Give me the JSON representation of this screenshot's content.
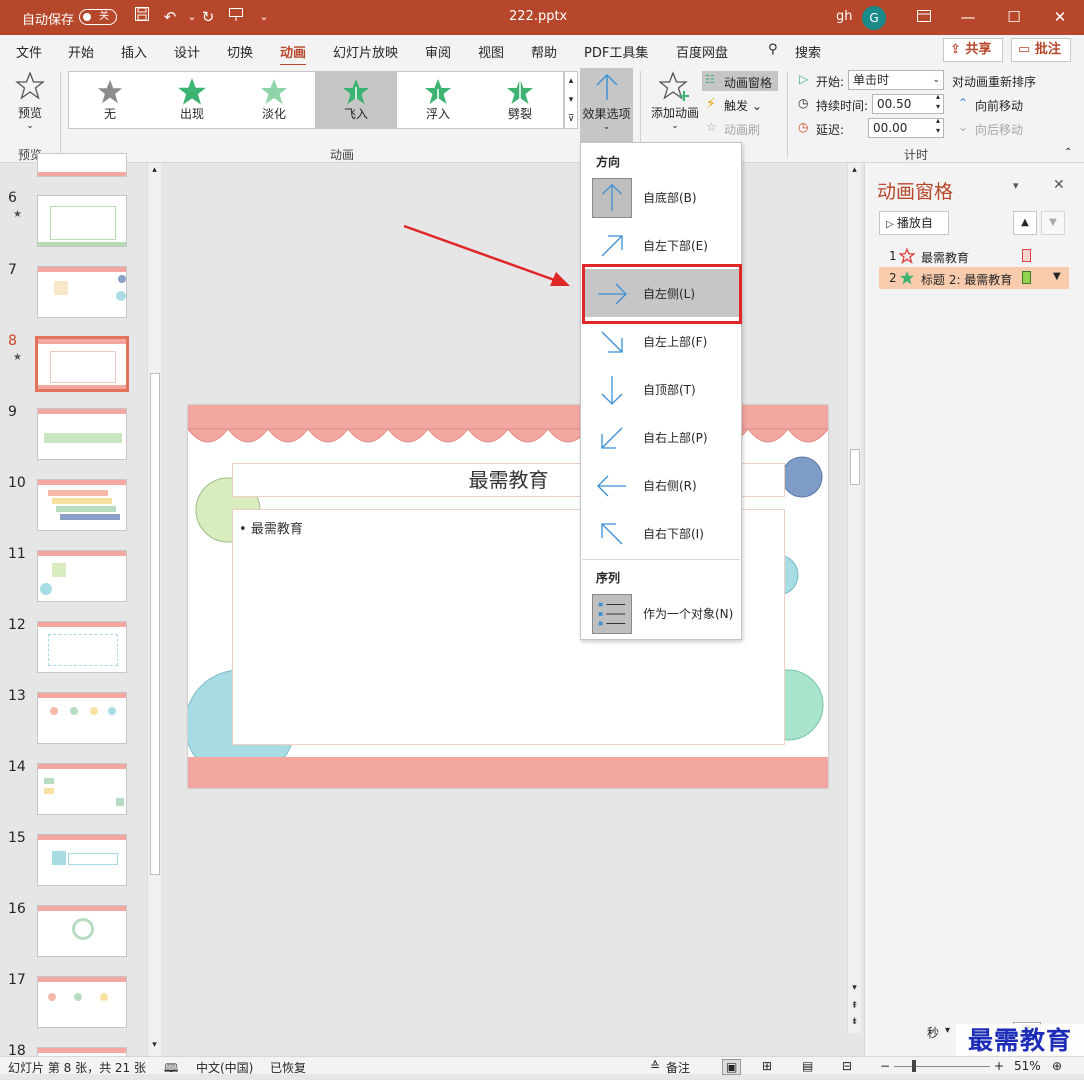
{
  "titlebar": {
    "autosave_label": "自动保存",
    "autosave_state": "关",
    "filename": "222.pptx",
    "user_initials": "gh",
    "avatar_letter": "G"
  },
  "menu": {
    "items": [
      "文件",
      "开始",
      "插入",
      "设计",
      "切换",
      "动画",
      "幻灯片放映",
      "审阅",
      "视图",
      "帮助",
      "PDF工具集",
      "百度网盘"
    ],
    "active": "动画",
    "search": "搜索",
    "share": "共享",
    "comments": "批注"
  },
  "ribbon": {
    "preview_label": "预览",
    "preview_group": "预览",
    "gallery": [
      {
        "label": "无",
        "color": "#808080"
      },
      {
        "label": "出现",
        "color": "#3cb371"
      },
      {
        "label": "淡化",
        "color": "#3cb371"
      },
      {
        "label": "飞入",
        "color": "#3cb371"
      },
      {
        "label": "浮入",
        "color": "#3cb371"
      },
      {
        "label": "劈裂",
        "color": "#3cb371"
      }
    ],
    "selected_effect": "飞入",
    "animation_group": "动画",
    "effect_options": "效果选项",
    "add_animation": "添加动画",
    "animation_pane_btn": "动画窗格",
    "trigger": "触发",
    "painter": "动画刷",
    "start_label": "开始:",
    "start_value": "单击时",
    "duration_label": "持续时间:",
    "duration_value": "00.50",
    "delay_label": "延迟:",
    "delay_value": "00.00",
    "reorder_label": "对动画重新排序",
    "move_earlier": "向前移动",
    "move_later": "向后移动",
    "timing_group": "计时"
  },
  "slides": [
    {
      "num": "6",
      "star": true
    },
    {
      "num": "7",
      "star": false
    },
    {
      "num": "8",
      "star": true
    },
    {
      "num": "9",
      "star": false
    },
    {
      "num": "10",
      "star": false
    },
    {
      "num": "11",
      "star": false
    },
    {
      "num": "12",
      "star": false
    },
    {
      "num": "13",
      "star": false
    },
    {
      "num": "14",
      "star": false
    },
    {
      "num": "15",
      "star": false
    },
    {
      "num": "16",
      "star": false
    },
    {
      "num": "17",
      "star": false
    },
    {
      "num": "18",
      "star": false
    }
  ],
  "current_slide": "8",
  "slide": {
    "title": "最需教育",
    "bullet": "最需教育"
  },
  "dropdown": {
    "direction_header": "方向",
    "directions": [
      "自底部(B)",
      "自左下部(E)",
      "自左侧(L)",
      "自左上部(F)",
      "自顶部(T)",
      "自右上部(P)",
      "自右侧(R)",
      "自右下部(I)"
    ],
    "current_direction": "自底部(B)",
    "hover_direction": "自左侧(L)",
    "sequence_header": "序列",
    "sequence_option": "作为一个对象(N)"
  },
  "animation_pane": {
    "title": "动画窗格",
    "play_from": "播放自",
    "items": [
      {
        "index": "1",
        "label": "最需教育",
        "icon_color": "#e04040",
        "bar_color": "#f4c7c3"
      },
      {
        "index": "2",
        "label": "标题 2: 最需教育",
        "icon_color": "#3cb371",
        "bar_color": "#92d050"
      }
    ],
    "seconds": "秒",
    "timeline_zero": "0"
  },
  "statusbar": {
    "slide_info": "幻灯片 第 8 张，共 21 张",
    "language": "中文(中国)",
    "recovered": "已恢复",
    "notes": "备注",
    "zoom": "51%"
  },
  "watermark": "最需教育"
}
